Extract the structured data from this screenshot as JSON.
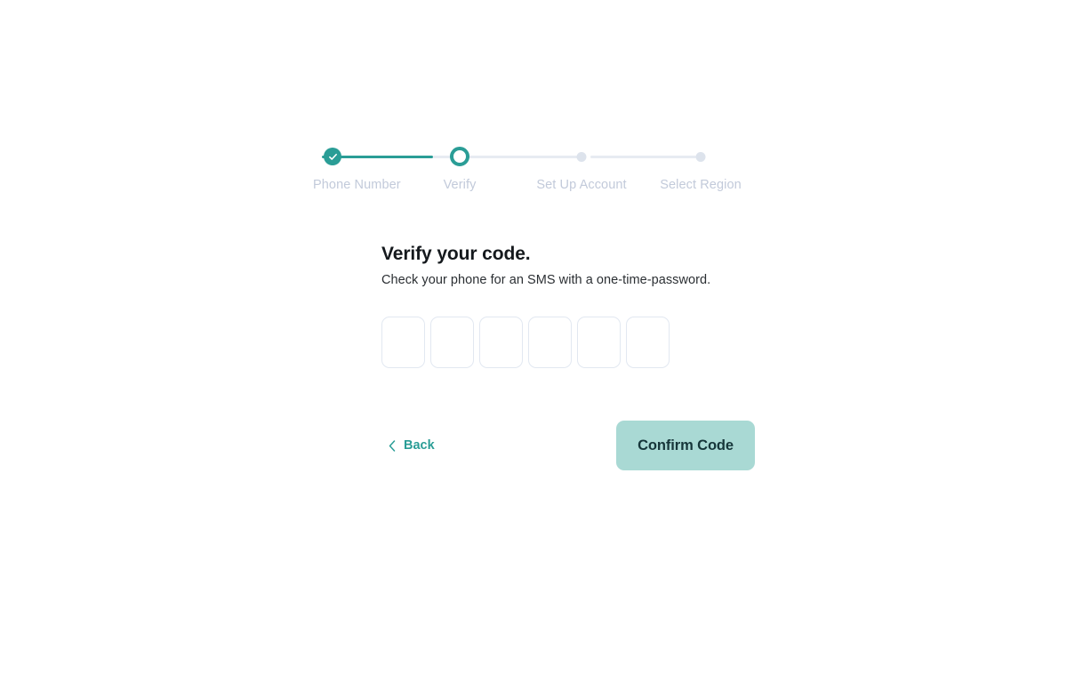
{
  "stepper": {
    "steps": [
      {
        "label": "Phone Number",
        "state": "completed",
        "icon": "check-icon"
      },
      {
        "label": "Verify",
        "state": "active",
        "icon": "ring-icon"
      },
      {
        "label": "Set Up Account",
        "state": "upcoming",
        "icon": "dot-icon"
      },
      {
        "label": "Select Region",
        "state": "upcoming",
        "icon": "dot-icon"
      }
    ],
    "colors": {
      "active": "#2a9d96",
      "completed": "#2a9d96",
      "upcoming": "#dde3ec",
      "connector_done": "#2a9d96",
      "connector_todo": "#e7ebf2",
      "label": "#c2cada"
    }
  },
  "form": {
    "title": "Verify your code.",
    "subtitle": "Check your phone for an SMS with a one-time-password.",
    "otp": {
      "length": 6,
      "values": [
        "",
        "",
        "",
        "",
        "",
        ""
      ],
      "placeholder": ""
    }
  },
  "actions": {
    "back_label": "Back",
    "back_icon": "chevron-left-icon",
    "confirm_label": "Confirm Code",
    "colors": {
      "back_text": "#2a9d96",
      "confirm_bg": "#a9d9d4",
      "confirm_text": "#16363a"
    }
  }
}
